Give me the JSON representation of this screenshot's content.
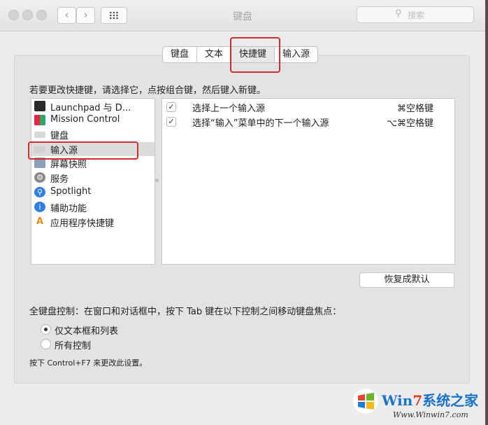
{
  "window": {
    "title": "键盘"
  },
  "search": {
    "placeholder": "搜索"
  },
  "nav": {
    "back": "‹",
    "forward": "›"
  },
  "tabs": [
    {
      "label": "键盘",
      "active": false
    },
    {
      "label": "文本",
      "active": false
    },
    {
      "label": "快捷键",
      "active": true
    },
    {
      "label": "输入源",
      "active": false
    }
  ],
  "instruction": "若要更改快捷键，请选择它，点按组合键，然后键入新键。",
  "categories": [
    {
      "label": "Launchpad 与 D...",
      "icon": "launchpad-icon",
      "color": "#2a2a2a"
    },
    {
      "label": "Mission Control",
      "icon": "mission-control-icon",
      "color": "#3a3a3a"
    },
    {
      "label": "键盘",
      "icon": "keyboard-icon",
      "color": "#d8d8d8"
    },
    {
      "label": "输入源",
      "icon": "input-source-icon",
      "color": "#d8d8d8",
      "selected": true
    },
    {
      "label": "屏幕快照",
      "icon": "screenshot-icon",
      "color": "#8aa0b8"
    },
    {
      "label": "服务",
      "icon": "gear-icon",
      "color": "#8a8a8a"
    },
    {
      "label": "Spotlight",
      "icon": "spotlight-icon",
      "color": "#2f7fe0"
    },
    {
      "label": "辅助功能",
      "icon": "accessibility-icon",
      "color": "#2f7fe0"
    },
    {
      "label": "应用程序快捷键",
      "icon": "app-shortcuts-icon",
      "color": "#e08a20"
    }
  ],
  "shortcuts": [
    {
      "checked": true,
      "description": "选择上一个输入源",
      "key": "⌘空格键"
    },
    {
      "checked": true,
      "description": "选择“输入”菜单中的下一个输入源",
      "key": "⌥⌘空格键"
    }
  ],
  "restore_button": "恢复成默认",
  "keyboard_control": {
    "label": "全键盘控制：在窗口和对话框中，按下 Tab 键在以下控制之间移动键盘焦点：",
    "options": [
      {
        "label": "仅文本框和列表",
        "selected": true
      },
      {
        "label": "所有控制",
        "selected": false
      }
    ]
  },
  "hint": "按下 Control+F7 来更改此设置。",
  "watermark": {
    "brand_prefix": "Win",
    "brand_seven": "7",
    "brand_suffix": "系统之家",
    "url": "Www.Winwin7.com"
  }
}
